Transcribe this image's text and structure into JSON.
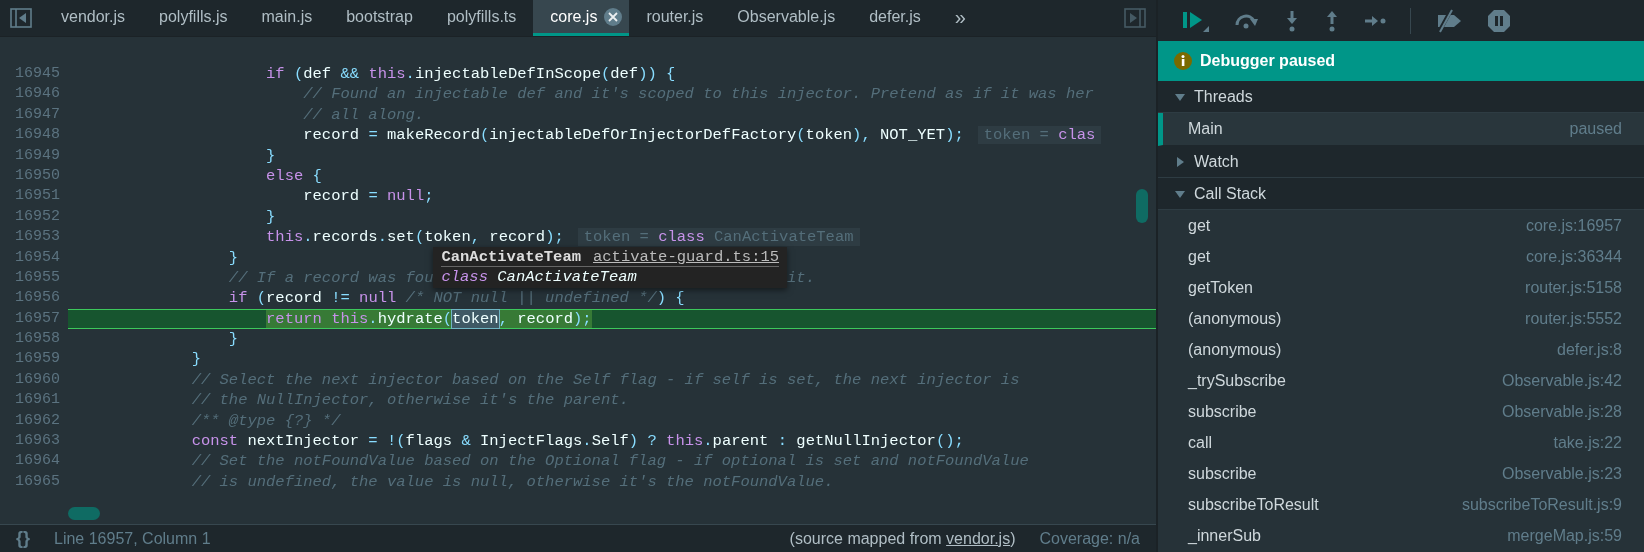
{
  "editor": {
    "tabs": [
      {
        "label": "vendor.js",
        "selected": false
      },
      {
        "label": "polyfills.js",
        "selected": false
      },
      {
        "label": "main.js",
        "selected": false
      },
      {
        "label": "bootstrap",
        "selected": false
      },
      {
        "label": "polyfills.ts",
        "selected": false
      },
      {
        "label": "core.js",
        "selected": true
      },
      {
        "label": "router.js",
        "selected": false
      },
      {
        "label": "Observable.js",
        "selected": false
      },
      {
        "label": "defer.js",
        "selected": false
      }
    ],
    "overflow": "»",
    "lines": [
      {
        "number": "16945",
        "current": false,
        "code": [
          {
            "t": "                    if",
            "kind": "keyword"
          },
          {
            "t": " (",
            "kind": "punctuation"
          },
          {
            "t": "def ",
            "kind": "identifier"
          },
          {
            "t": "&& ",
            "kind": "punctuation"
          },
          {
            "t": "this",
            "kind": "keyword"
          },
          {
            "t": ".",
            "kind": "punctuation"
          },
          {
            "t": "injectableDefInScope",
            "kind": "identifier"
          },
          {
            "t": "(",
            "kind": "punctuation"
          },
          {
            "t": "def",
            "kind": "identifier"
          },
          {
            "t": ")) {",
            "kind": "punctuation"
          }
        ]
      },
      {
        "number": "16946",
        "current": false,
        "code": [
          {
            "t": "                        // Found an injectable def and it's scoped to this injector. Pretend as if it was her",
            "kind": "comment"
          }
        ]
      },
      {
        "number": "16947",
        "current": false,
        "code": [
          {
            "t": "                        // all along.",
            "kind": "comment"
          }
        ]
      },
      {
        "number": "16948",
        "current": false,
        "code": [
          {
            "t": "                        record ",
            "kind": "identifier"
          },
          {
            "t": "= ",
            "kind": "punctuation"
          },
          {
            "t": "makeRecord",
            "kind": "identifier"
          },
          {
            "t": "(",
            "kind": "punctuation"
          },
          {
            "t": "injectableDefOrInjectorDefFactory",
            "kind": "identifier"
          },
          {
            "t": "(",
            "kind": "punctuation"
          },
          {
            "t": "token",
            "kind": "identifier"
          },
          {
            "t": "),",
            "kind": "punctuation"
          },
          {
            "t": " NOT_YET",
            "kind": "identifier"
          },
          {
            "t": ");",
            "kind": "punctuation"
          }
        ],
        "hint": [
          {
            "t": "token = ",
            "kind": "identifier"
          },
          {
            "t": "clas",
            "kind": "keyword"
          }
        ]
      },
      {
        "number": "16949",
        "current": false,
        "code": [
          {
            "t": "                    }",
            "kind": "punctuation"
          }
        ]
      },
      {
        "number": "16950",
        "current": false,
        "code": [
          {
            "t": "                    else",
            "kind": "keyword"
          },
          {
            "t": " {",
            "kind": "punctuation"
          }
        ]
      },
      {
        "number": "16951",
        "current": false,
        "code": [
          {
            "t": "                        record ",
            "kind": "identifier"
          },
          {
            "t": "= ",
            "kind": "punctuation"
          },
          {
            "t": "null",
            "kind": "keyword"
          },
          {
            "t": ";",
            "kind": "punctuation"
          }
        ]
      },
      {
        "number": "16952",
        "current": false,
        "code": [
          {
            "t": "                    }",
            "kind": "punctuation"
          }
        ]
      },
      {
        "number": "16953",
        "current": false,
        "code": [
          {
            "t": "                    this",
            "kind": "keyword"
          },
          {
            "t": ".",
            "kind": "punctuation"
          },
          {
            "t": "records",
            "kind": "identifier"
          },
          {
            "t": ".",
            "kind": "punctuation"
          },
          {
            "t": "set",
            "kind": "identifier"
          },
          {
            "t": "(",
            "kind": "punctuation"
          },
          {
            "t": "token",
            "kind": "identifier"
          },
          {
            "t": ", ",
            "kind": "punctuation"
          },
          {
            "t": "record",
            "kind": "identifier"
          },
          {
            "t": ");",
            "kind": "punctuation"
          }
        ],
        "hint": [
          {
            "t": "token = ",
            "kind": "identifier"
          },
          {
            "t": "class",
            "kind": "keyword"
          },
          {
            "t": " CanActivateTeam",
            "kind": "identifier"
          }
        ]
      },
      {
        "number": "16954",
        "current": false,
        "code": [
          {
            "t": "                }",
            "kind": "punctuation"
          }
        ]
      },
      {
        "number": "16955",
        "current": false,
        "code": [
          {
            "t": "                // If a record was fou",
            "kind": "comment"
          },
          {
            "kind": "tooltip"
          },
          {
            "t": "it.",
            "kind": "comment"
          }
        ]
      },
      {
        "number": "16956",
        "current": false,
        "code": [
          {
            "t": "                if",
            "kind": "keyword"
          },
          {
            "t": " (",
            "kind": "punctuation"
          },
          {
            "t": "record ",
            "kind": "identifier"
          },
          {
            "t": "!= ",
            "kind": "punctuation"
          },
          {
            "t": "null",
            "kind": "keyword"
          },
          {
            "t": " /* NOT null || undefined */",
            "kind": "comment"
          },
          {
            "t": ") {",
            "kind": "punctuation"
          }
        ]
      },
      {
        "number": "16957",
        "current": true,
        "code": [
          {
            "t": "                    return this",
            "kind": "keyword"
          },
          {
            "t": ".",
            "kind": "punctuation"
          },
          {
            "t": "hydrate",
            "kind": "identifier"
          },
          {
            "t": "(",
            "kind": "punctuation"
          },
          {
            "t": "token",
            "kind": "hover"
          },
          {
            "t": ", ",
            "kind": "punctuation"
          },
          {
            "t": "record",
            "kind": "identifier"
          },
          {
            "t": ");",
            "kind": "punctuation"
          }
        ]
      },
      {
        "number": "16958",
        "current": false,
        "code": [
          {
            "t": "                }",
            "kind": "punctuation"
          }
        ]
      },
      {
        "number": "16959",
        "current": false,
        "code": [
          {
            "t": "            }",
            "kind": "punctuation"
          }
        ]
      },
      {
        "number": "16960",
        "current": false,
        "code": [
          {
            "t": "            // Select the next injector based on the Self flag - if self is set, the next injector is",
            "kind": "comment"
          }
        ]
      },
      {
        "number": "16961",
        "current": false,
        "code": [
          {
            "t": "            // the NullInjector, otherwise it's the parent.",
            "kind": "comment"
          }
        ]
      },
      {
        "number": "16962",
        "current": false,
        "code": [
          {
            "t": "            /** @type {?} */",
            "kind": "comment"
          }
        ]
      },
      {
        "number": "16963",
        "current": false,
        "code": [
          {
            "t": "            const ",
            "kind": "keyword"
          },
          {
            "t": "nextInjector ",
            "kind": "identifier"
          },
          {
            "t": "= !(",
            "kind": "punctuation"
          },
          {
            "t": "flags ",
            "kind": "identifier"
          },
          {
            "t": "& ",
            "kind": "punctuation"
          },
          {
            "t": "InjectFlags",
            "kind": "identifier"
          },
          {
            "t": ".",
            "kind": "punctuation"
          },
          {
            "t": "Self",
            "kind": "identifier"
          },
          {
            "t": ") ? ",
            "kind": "punctuation"
          },
          {
            "t": "this",
            "kind": "keyword"
          },
          {
            "t": ".",
            "kind": "punctuation"
          },
          {
            "t": "parent ",
            "kind": "identifier"
          },
          {
            "t": ": ",
            "kind": "punctuation"
          },
          {
            "t": "getNullInjector",
            "kind": "identifier"
          },
          {
            "t": "();",
            "kind": "punctuation"
          }
        ]
      },
      {
        "number": "16964",
        "current": false,
        "code": [
          {
            "t": "            // Set the notFoundValue based on the Optional flag - if optional is set and notFoundValue",
            "kind": "comment"
          }
        ]
      },
      {
        "number": "16965",
        "current": false,
        "code": [
          {
            "t": "            // is undefined, the value is null, otherwise it's the notFoundValue.",
            "kind": "comment"
          }
        ]
      }
    ],
    "tooltip": {
      "title": "CanActivateTeam",
      "link": "activate-guard.ts:15",
      "detail": [
        {
          "t": "class",
          "kind": "keyword"
        },
        {
          "t": " CanActivateTeam",
          "kind": "identifier"
        }
      ]
    }
  },
  "status_bar": {
    "format": "{}",
    "position": "Line 16957, Column 1",
    "source_prefix": "(source mapped from ",
    "source_link": "vendor.js",
    "source_suffix": ")",
    "coverage": "Coverage: n/a"
  },
  "debugger": {
    "banner": "Debugger paused",
    "sections": [
      {
        "kind": "threads",
        "title": "Threads",
        "expanded": true,
        "items": [
          {
            "name": "Main",
            "status": "paused",
            "selected": true
          }
        ]
      },
      {
        "kind": "watch",
        "title": "Watch",
        "expanded": false
      },
      {
        "kind": "frames",
        "title": "Call Stack",
        "expanded": true,
        "items": [
          {
            "name": "get",
            "location": "core.js:16957"
          },
          {
            "name": "get",
            "location": "core.js:36344"
          },
          {
            "name": "getToken",
            "location": "router.js:5158"
          },
          {
            "name": "(anonymous)",
            "location": "router.js:5552"
          },
          {
            "name": "(anonymous)",
            "location": "defer.js:8"
          },
          {
            "name": "_trySubscribe",
            "location": "Observable.js:42"
          },
          {
            "name": "subscribe",
            "location": "Observable.js:28"
          },
          {
            "name": "call",
            "location": "take.js:22"
          },
          {
            "name": "subscribe",
            "location": "Observable.js:23"
          },
          {
            "name": "subscribeToResult",
            "location": "subscribeToResult.js:9"
          },
          {
            "name": "_innerSub",
            "location": "mergeMap.js:59"
          }
        ]
      }
    ]
  }
}
